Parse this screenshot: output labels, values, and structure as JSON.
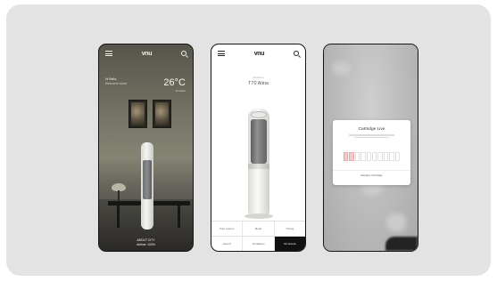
{
  "colors": {
    "card_bg": "#e3e3e3",
    "accent_active": "#111111",
    "cartridge_used": "#f4c9c9"
  },
  "phone_home": {
    "logo": "vnu",
    "greeting": "Hi Bella,",
    "greeting_sub": "Welcome home",
    "temperature": "26°C",
    "temperature_sub": "● Indoor",
    "footer_line1": "ABOUT CITY",
    "footer_line2": "Airflow: 100%"
  },
  "phone_product": {
    "logo": "vnu",
    "label": "Welcome",
    "product_name": "T70 Alina",
    "grid": [
      [
        {
          "label": "Pure system",
          "active": false
        },
        {
          "label": "Mode",
          "active": false
        },
        {
          "label": "Timing",
          "active": false
        }
      ],
      [
        {
          "label": "Humid",
          "active": false
        },
        {
          "label": "Ventilation",
          "active": false
        },
        {
          "label": "Air Aroma",
          "active": true
        }
      ]
    ]
  },
  "phone_cartridge": {
    "modal_title": "Cartridge Live",
    "bars_total": 10,
    "bars_used": 2,
    "modal_button": "Replace Cartridge"
  }
}
